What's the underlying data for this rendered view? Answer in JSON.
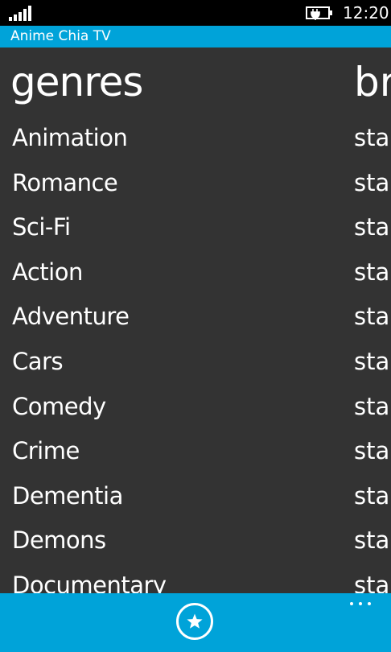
{
  "status_bar": {
    "time": "12:20",
    "signal_icon": "signal-bars-icon",
    "battery_icon": "battery-charging-icon"
  },
  "app": {
    "title": "Anime Chia TV"
  },
  "pivot": {
    "current_header": "genres",
    "next_header_partial": "br",
    "genres": [
      "Animation",
      "Romance",
      "Sci-Fi",
      "Action",
      "Adventure",
      "Cars",
      "Comedy",
      "Crime",
      "Dementia",
      "Demons",
      "Documentary"
    ],
    "next_column_partial": "sta"
  },
  "app_bar": {
    "favorite_icon": "star-icon",
    "more_icon": "more-dots-icon"
  },
  "colors": {
    "accent": "#00a3d9",
    "background": "#333333",
    "status_bar": "#000000"
  }
}
